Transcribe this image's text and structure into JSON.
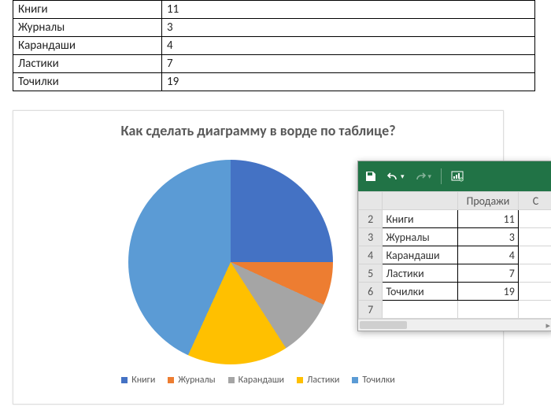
{
  "word_table": [
    {
      "name": "Книги",
      "value": "11"
    },
    {
      "name": "Журналы",
      "value": "3"
    },
    {
      "name": "Карандаши",
      "value": "4"
    },
    {
      "name": "Ластики",
      "value": "7"
    },
    {
      "name": "Точилки",
      "value": "19"
    }
  ],
  "chart_title": "Как сделать диаграмму в ворде по таблице?",
  "legend": [
    "Книги",
    "Журналы",
    "Карандаши",
    "Ластики",
    "Точилки"
  ],
  "colors": {
    "Книги": "#4472c4",
    "Журналы": "#ed7d31",
    "Карандаши": "#a5a5a5",
    "Ластики": "#ffc000",
    "Точилки": "#5b9bd5"
  },
  "excel": {
    "col_b_header": "Продажи",
    "col_c_header": "C",
    "col_a_header": "",
    "rows": [
      {
        "n": "2",
        "a": "Книги",
        "b": "11"
      },
      {
        "n": "3",
        "a": "Журналы",
        "b": "3"
      },
      {
        "n": "4",
        "a": "Карандаши",
        "b": "4"
      },
      {
        "n": "5",
        "a": "Ластики",
        "b": "7"
      },
      {
        "n": "6",
        "a": "Точилки",
        "b": "19"
      },
      {
        "n": "7",
        "a": "",
        "b": ""
      }
    ]
  },
  "chart_data": {
    "type": "pie",
    "title": "Как сделать диаграмму в ворде по таблице?",
    "categories": [
      "Книги",
      "Журналы",
      "Карандаши",
      "Ластики",
      "Точилки"
    ],
    "values": [
      11,
      3,
      4,
      7,
      19
    ],
    "series": [
      {
        "name": "Продажи",
        "values": [
          11,
          3,
          4,
          7,
          19
        ]
      }
    ],
    "colors": [
      "#4472c4",
      "#ed7d31",
      "#a5a5a5",
      "#ffc000",
      "#5b9bd5"
    ],
    "legend_position": "bottom"
  }
}
